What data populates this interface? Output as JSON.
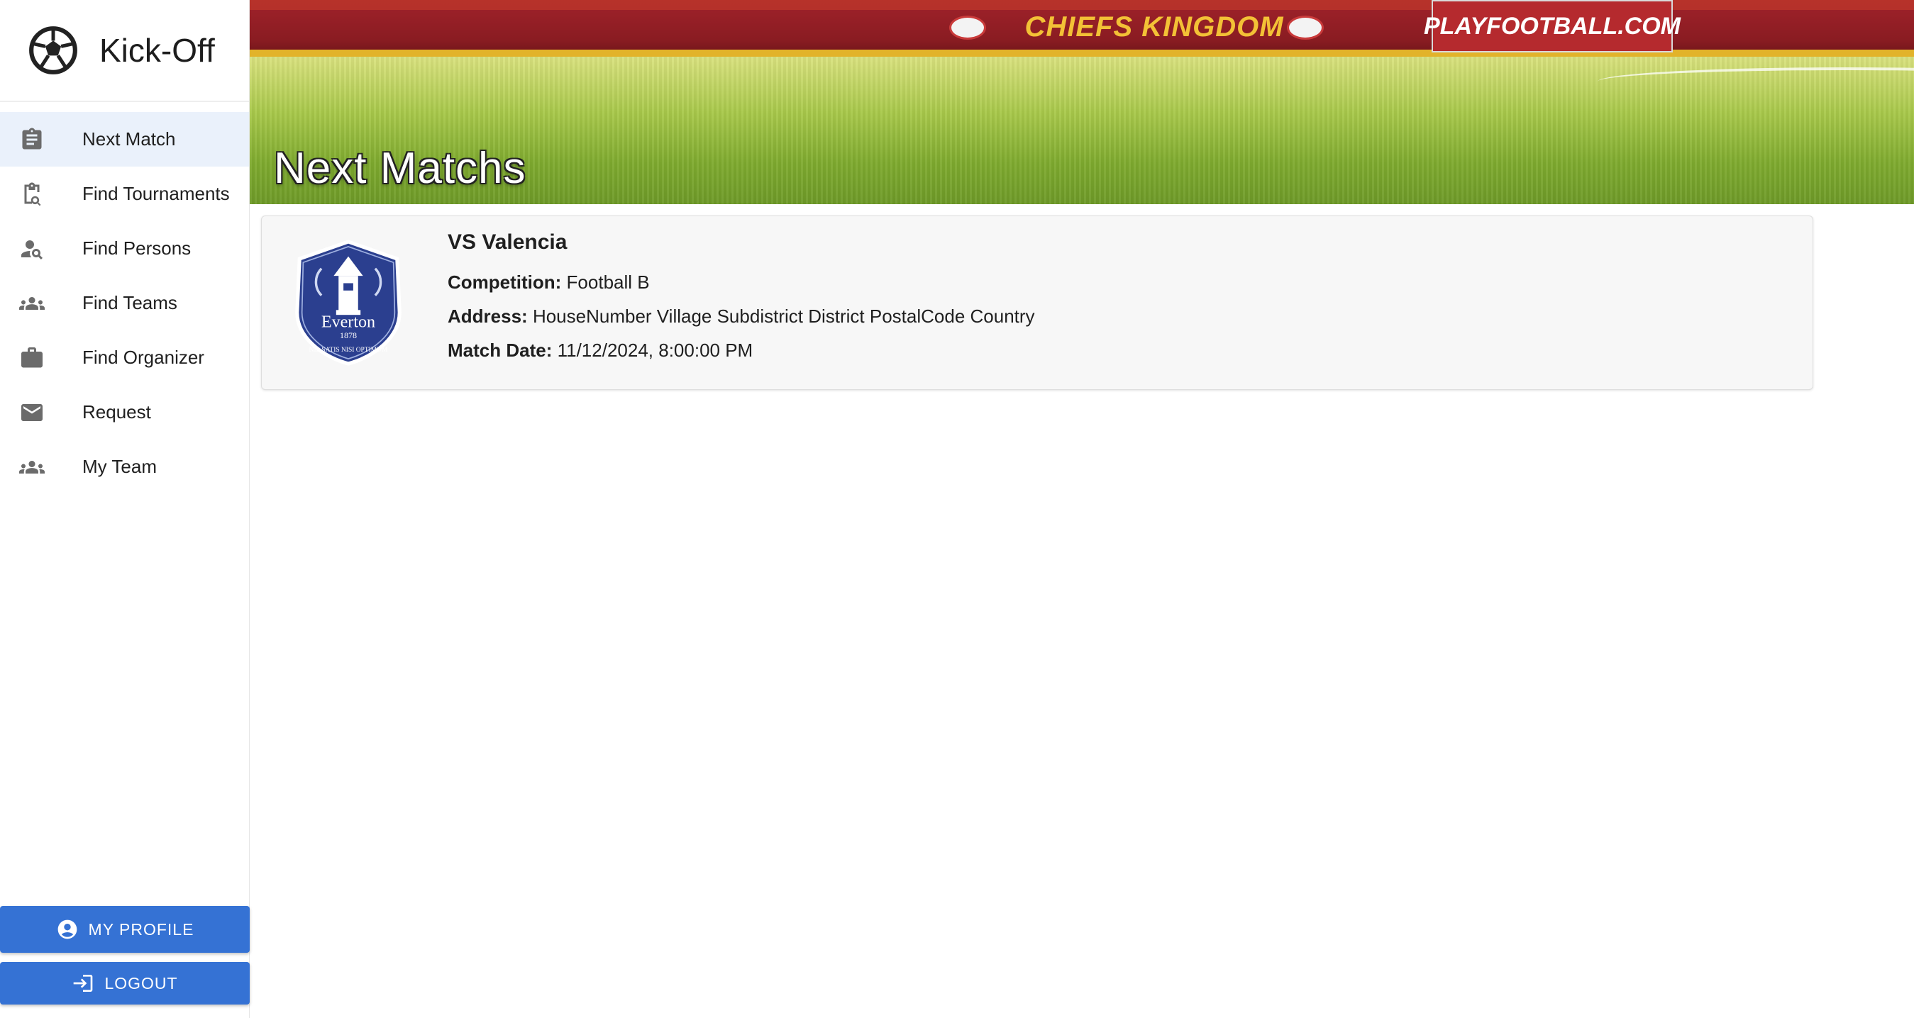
{
  "app": {
    "name": "Kick-Off"
  },
  "sidebar": {
    "items": [
      {
        "label": "Next Match",
        "icon": "clipboard-icon",
        "active": true
      },
      {
        "label": "Find Tournaments",
        "icon": "clipboard-search-icon"
      },
      {
        "label": "Find Persons",
        "icon": "person-search-icon"
      },
      {
        "label": "Find Teams",
        "icon": "groups-icon"
      },
      {
        "label": "Find Organizer",
        "icon": "briefcase-icon"
      },
      {
        "label": "Request",
        "icon": "mail-icon"
      },
      {
        "label": "My Team",
        "icon": "team-icon"
      }
    ],
    "profile_label": "MY PROFILE",
    "logout_label": "LOGOUT"
  },
  "hero": {
    "title": "Next Matchs",
    "banner_left": "CHIEFS KINGDOM",
    "banner_right": "PLAYFOOTBALL.COM"
  },
  "match": {
    "title": "VS Valencia",
    "competition_label": "Competition:",
    "competition": "Football B",
    "address_label": "Address:",
    "address": "HouseNumber Village Subdistrict District PostalCode Country",
    "date_label": "Match Date:",
    "date": "11/12/2024, 8:00:00 PM",
    "crest": {
      "name": "Everton",
      "year": "1878",
      "motto": "NIL SATIS NISI OPTIMUM"
    }
  },
  "colors": {
    "primary": "#3572d4",
    "active_bg": "#eaf1fb",
    "crest_blue": "#2b3f8f"
  }
}
